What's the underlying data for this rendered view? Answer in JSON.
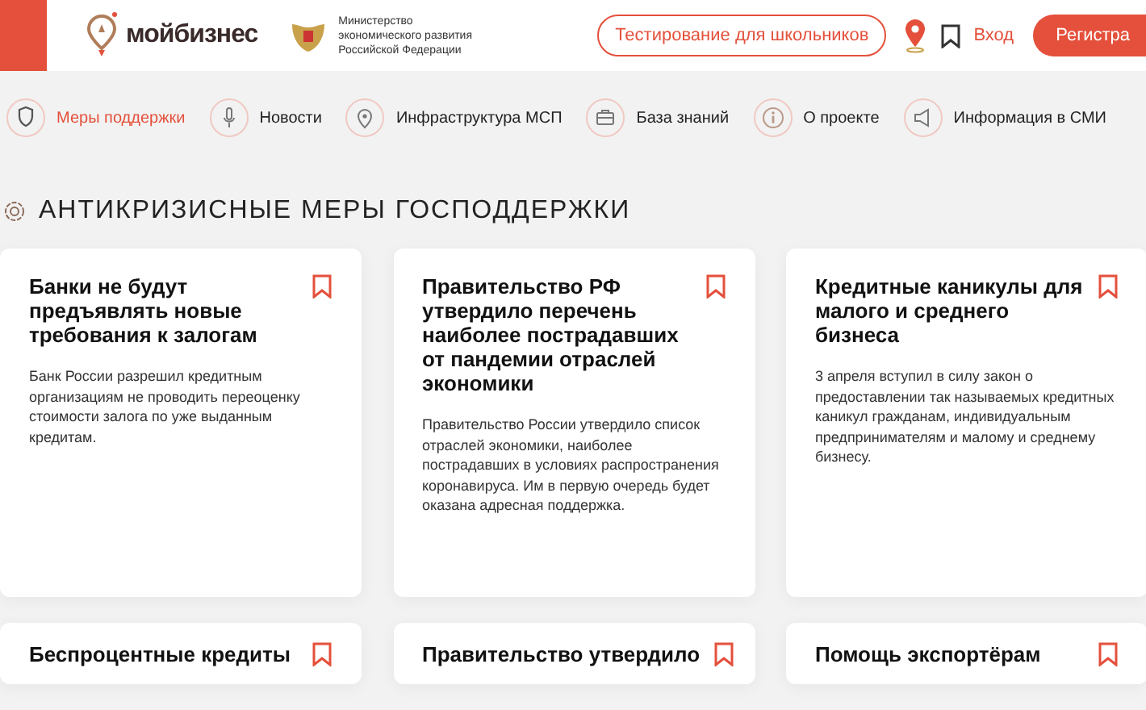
{
  "header": {
    "logo_text": "мойбизнес",
    "ministry": "Министерство экономического развития Российской Федерации",
    "test_button": "Тестирование для школьников",
    "login": "Вход",
    "register": "Регистра"
  },
  "nav": [
    {
      "label": "Меры поддержки",
      "selected": true
    },
    {
      "label": "Новости",
      "selected": false
    },
    {
      "label": "Инфраструктура МСП",
      "selected": false
    },
    {
      "label": "База знаний",
      "selected": false
    },
    {
      "label": "О проекте",
      "selected": false
    },
    {
      "label": "Информация в СМИ",
      "selected": false
    }
  ],
  "section_title": "АНТИКРИЗИСНЫЕ МЕРЫ ГОСПОДДЕРЖКИ",
  "cards": [
    {
      "title": "Банки не будут предъявлять новые требования к залогам",
      "text": "Банк России разрешил кредитным организациям не проводить переоценку стоимости залога по уже выданным кредитам."
    },
    {
      "title": "Правительство РФ утвердило перечень наиболее пострадавших от пандемии отраслей экономики",
      "text": "Правительство России утвердило список отраслей экономики, наиболее пострадавших в условиях распространения коронавируса. Им в первую очередь будет оказана адресная поддержка."
    },
    {
      "title": "Кредитные каникулы для малого и среднего бизнеса",
      "text": "3 апреля вступил в силу закон о предоставлении так называемых кредитных каникул гражданам, индивидуальным предпринимателям и малому и среднему бизнесу."
    },
    {
      "title": "Беспроцентные кредиты"
    },
    {
      "title": "Правительство утвердило"
    },
    {
      "title": "Помощь экспортёрам"
    }
  ]
}
